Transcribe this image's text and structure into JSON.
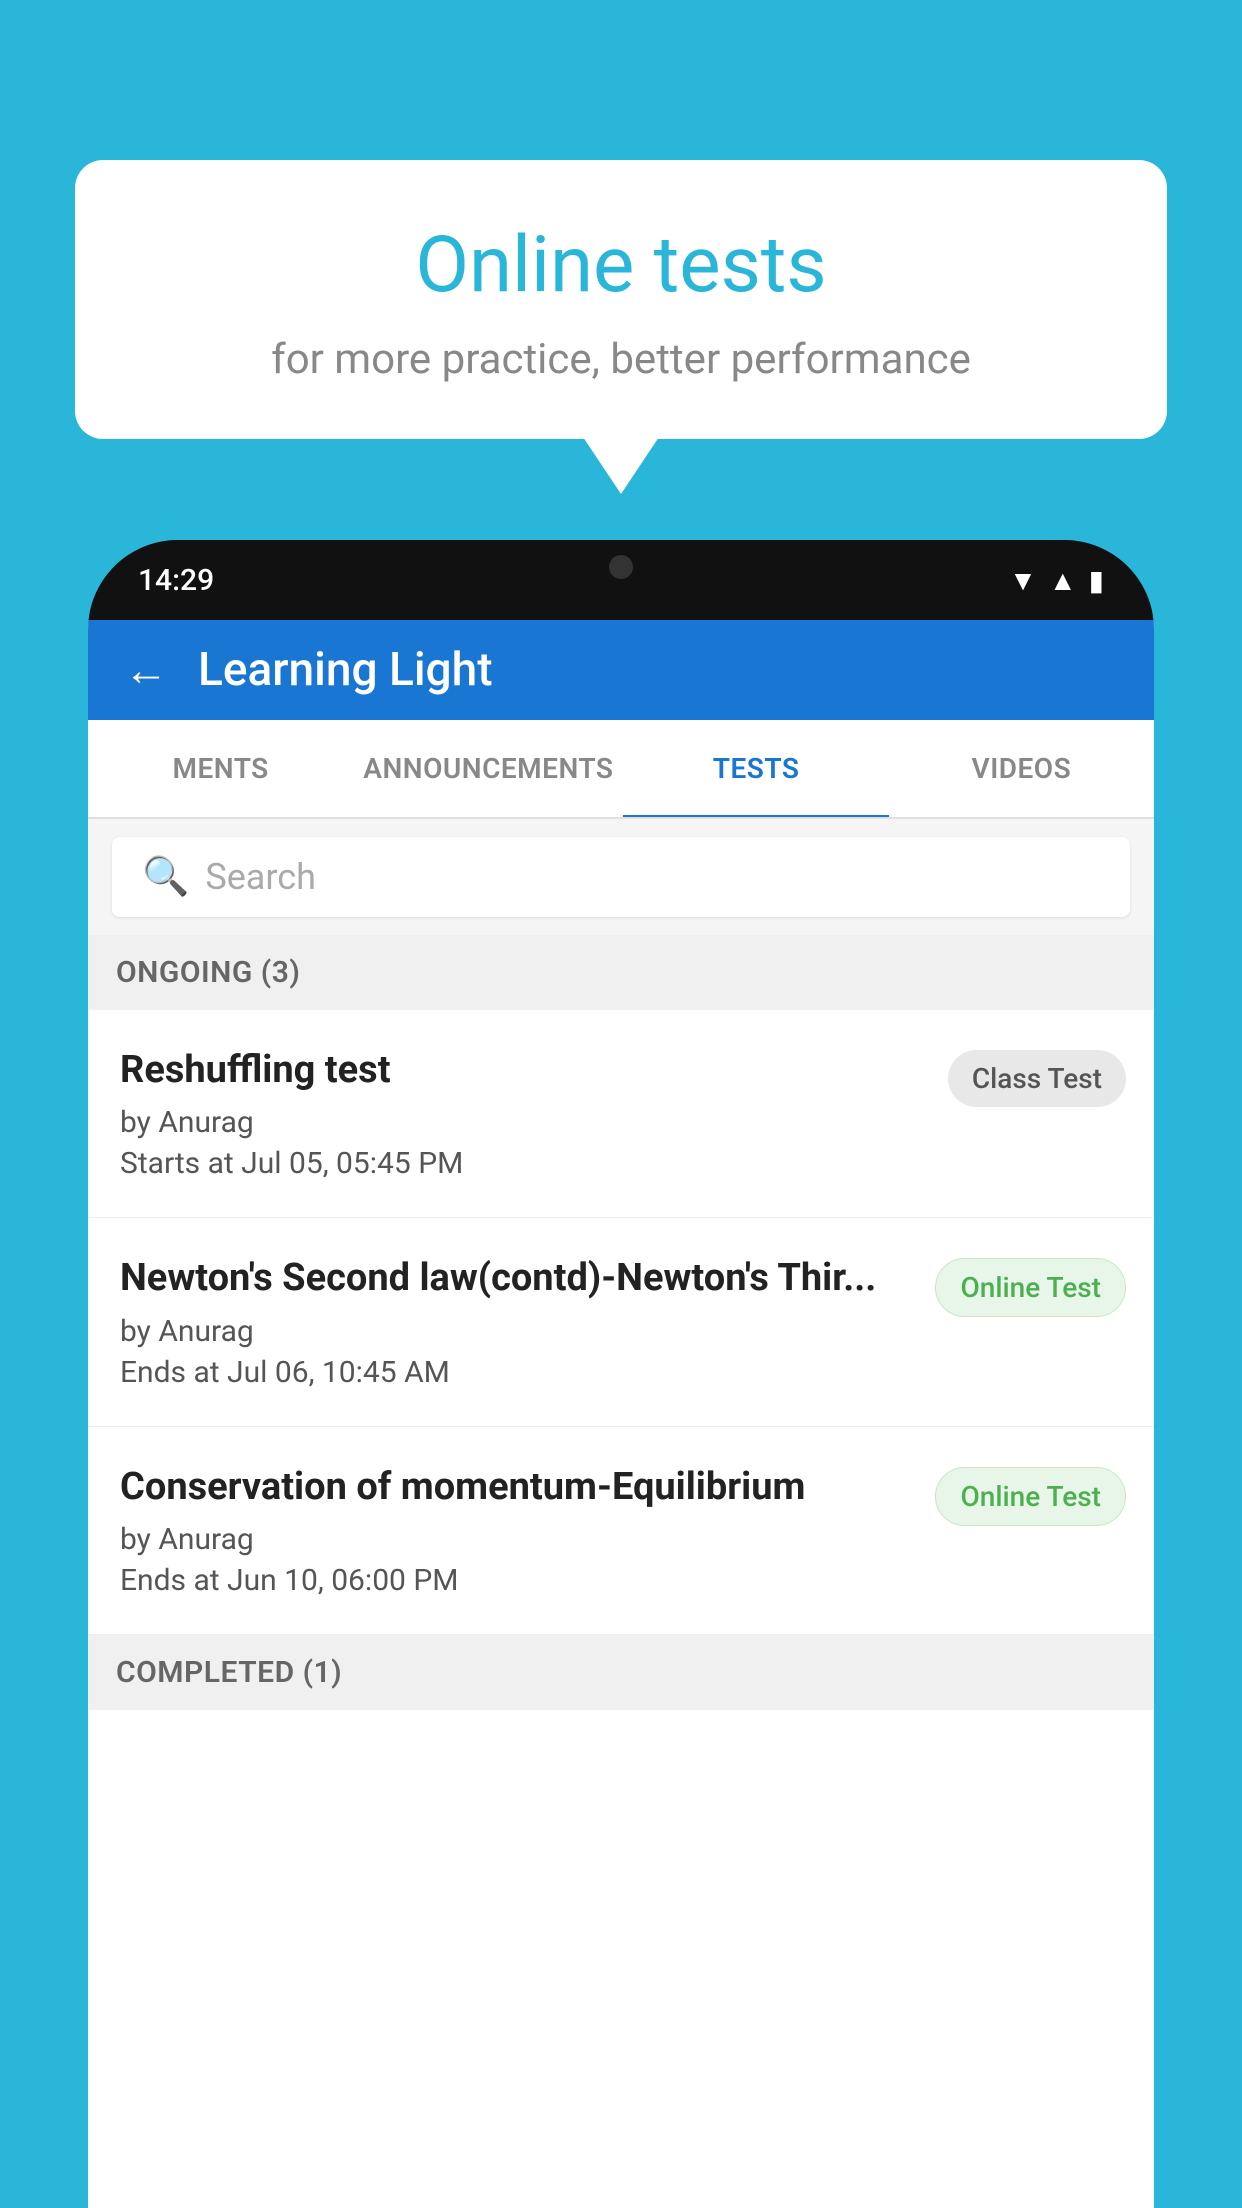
{
  "background": {
    "color": "#29b6d8"
  },
  "bubble": {
    "title": "Online tests",
    "subtitle": "for more practice, better performance"
  },
  "phone": {
    "status": {
      "time": "14:29"
    },
    "appBar": {
      "title": "Learning Light",
      "back_label": "←"
    },
    "tabs": [
      {
        "label": "MENTS",
        "active": false
      },
      {
        "label": "ANNOUNCEMENTS",
        "active": false
      },
      {
        "label": "TESTS",
        "active": true
      },
      {
        "label": "VIDEOS",
        "active": false
      }
    ],
    "search": {
      "placeholder": "Search"
    },
    "ongoing": {
      "header": "ONGOING (3)",
      "items": [
        {
          "name": "Reshuffling test",
          "by": "by Anurag",
          "date": "Starts at  Jul 05, 05:45 PM",
          "badge": "Class Test",
          "badge_type": "class"
        },
        {
          "name": "Newton's Second law(contd)-Newton's Thir...",
          "by": "by Anurag",
          "date": "Ends at  Jul 06, 10:45 AM",
          "badge": "Online Test",
          "badge_type": "online"
        },
        {
          "name": "Conservation of momentum-Equilibrium",
          "by": "by Anurag",
          "date": "Ends at  Jun 10, 06:00 PM",
          "badge": "Online Test",
          "badge_type": "online"
        }
      ]
    },
    "completed": {
      "header": "COMPLETED (1)"
    }
  }
}
